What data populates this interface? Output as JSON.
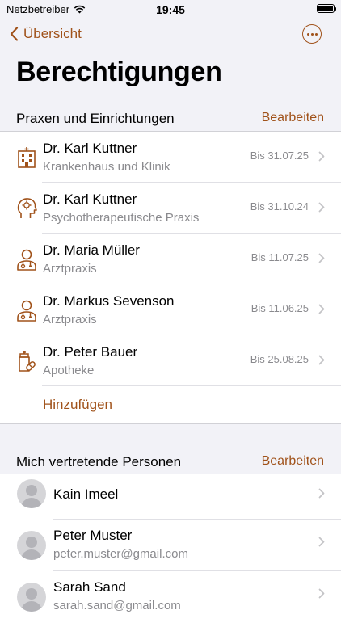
{
  "status": {
    "carrier": "Netzbetreiber",
    "time": "19:45"
  },
  "nav": {
    "back_label": "Übersicht"
  },
  "title": "Berechtigungen",
  "sections": {
    "practices": {
      "title": "Praxen und Einrichtungen",
      "edit_label": "Bearbeiten",
      "add_label": "Hinzufügen"
    },
    "representatives": {
      "title": "Mich vertretende Personen",
      "edit_label": "Bearbeiten"
    }
  },
  "practices": [
    {
      "name": "Dr. Karl Kuttner",
      "type": "Krankenhaus und Klinik",
      "valid_until": "Bis 31.07.25",
      "icon": "hospital-icon"
    },
    {
      "name": "Dr. Karl Kuttner",
      "type": "Psychotherapeutische Praxis",
      "valid_until": "Bis 31.10.24",
      "icon": "psychology-icon"
    },
    {
      "name": "Dr. Maria Müller",
      "type": "Arztpraxis",
      "valid_until": "Bis 11.07.25",
      "icon": "doctor-icon"
    },
    {
      "name": "Dr. Markus Sevenson",
      "type": "Arztpraxis",
      "valid_until": "Bis 11.06.25",
      "icon": "doctor-icon"
    },
    {
      "name": "Dr. Peter Bauer",
      "type": "Apotheke",
      "valid_until": "Bis 25.08.25",
      "icon": "pharmacy-icon"
    }
  ],
  "representatives": [
    {
      "name": "Kain Imeel",
      "email": ""
    },
    {
      "name": "Peter Muster",
      "email": "peter.muster@gmail.com"
    },
    {
      "name": "Sarah Sand",
      "email": "sarah.sand@gmail.com"
    }
  ],
  "colors": {
    "accent": "#a0521a",
    "background": "#f2f2f7",
    "secondary_text": "#8a8a8e"
  }
}
